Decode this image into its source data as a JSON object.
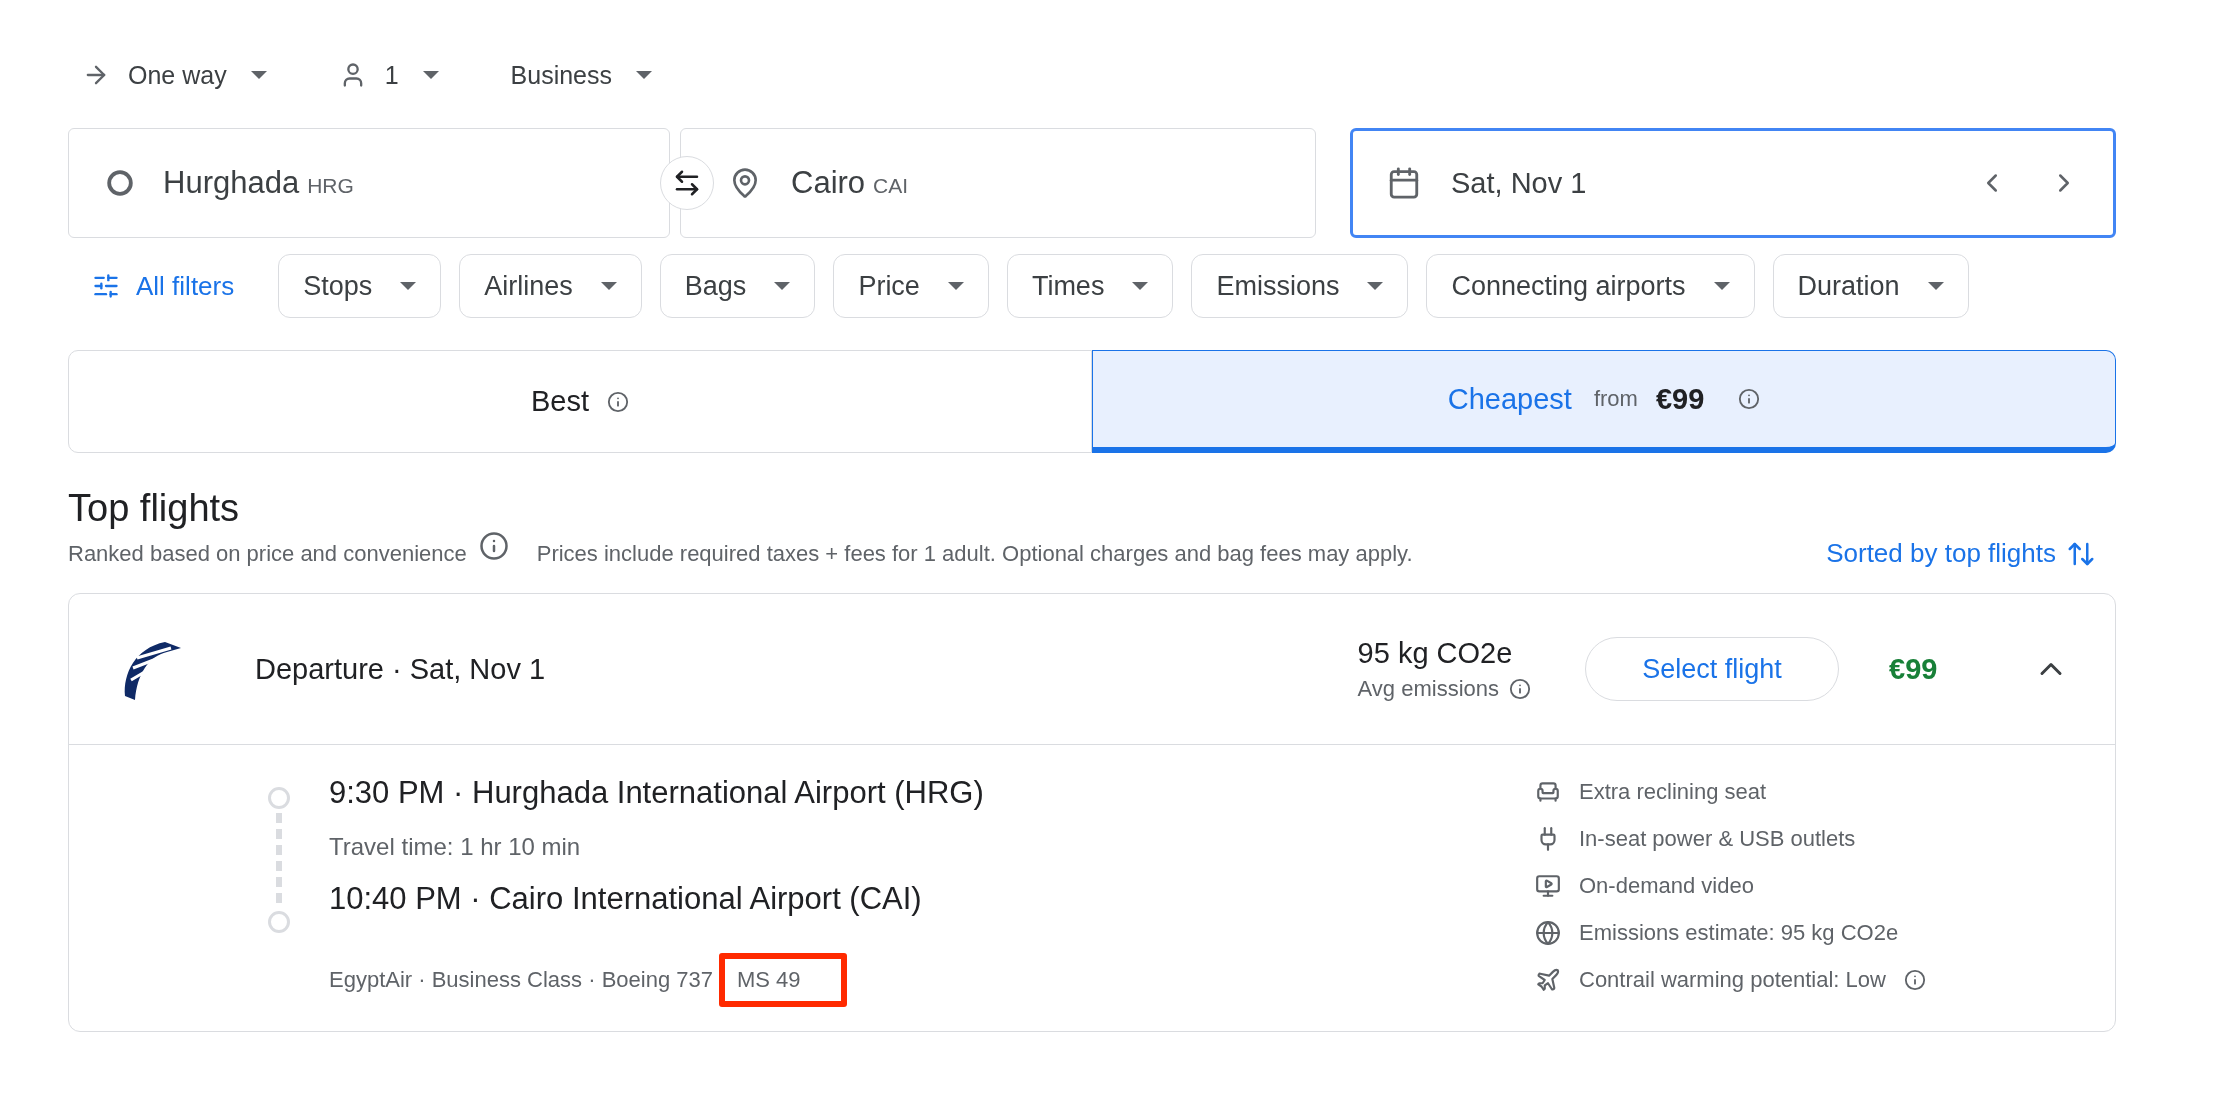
{
  "trip_options": [
    {
      "kind": "trip_type",
      "label": "One way"
    },
    {
      "kind": "passengers",
      "label": "1"
    },
    {
      "kind": "cabin",
      "label": "Business"
    }
  ],
  "search": {
    "origin": {
      "name": "Hurghada",
      "code": "HRG"
    },
    "destination": {
      "name": "Cairo",
      "code": "CAI"
    },
    "date": {
      "value": "Sat, Nov 1",
      "focused": true
    }
  },
  "filters": {
    "all_filters": "All filters",
    "chips": [
      "Stops",
      "Airlines",
      "Bags",
      "Price",
      "Times",
      "Emissions",
      "Connecting airports",
      "Duration"
    ]
  },
  "sort_tabs": [
    {
      "label": "Best",
      "selected": false
    },
    {
      "label": "Cheapest",
      "from_label": "from",
      "price": "€99",
      "selected": true
    }
  ],
  "results": {
    "title": "Top flights",
    "subtitle": "Ranked based on price and convenience",
    "note": "Prices include required taxes + fees for 1 adult. Optional charges and bag fees may apply.",
    "sort": "Sorted by top flights"
  },
  "flight": {
    "title": "Departure · Sat, Nov 1",
    "emissions": "95 kg CO2e",
    "emissions_label": "Avg emissions",
    "select": "Select flight",
    "price": "€99",
    "expanded": true,
    "departure": "9:30 PM · Hurghada International Airport (HRG)",
    "travel_time": "Travel time: 1 hr 10 min",
    "arrival": "10:40 PM · Cairo International Airport (CAI)",
    "details": [
      {
        "text": "EgyptAir · Business Class · Boeing 737",
        "highlighted": false
      },
      {
        "text": "MS 49",
        "highlighted": true
      }
    ],
    "amenities": [
      {
        "kind": "seat",
        "text": "Extra reclining seat",
        "info": false
      },
      {
        "kind": "power",
        "text": "In-seat power & USB outlets",
        "info": false
      },
      {
        "kind": "video",
        "text": "On-demand video",
        "info": false
      },
      {
        "kind": "emissions",
        "text": "Emissions estimate: 95 kg CO2e",
        "info": false
      },
      {
        "kind": "contrail",
        "text": "Contrail warming potential: Low",
        "info": true
      }
    ]
  }
}
